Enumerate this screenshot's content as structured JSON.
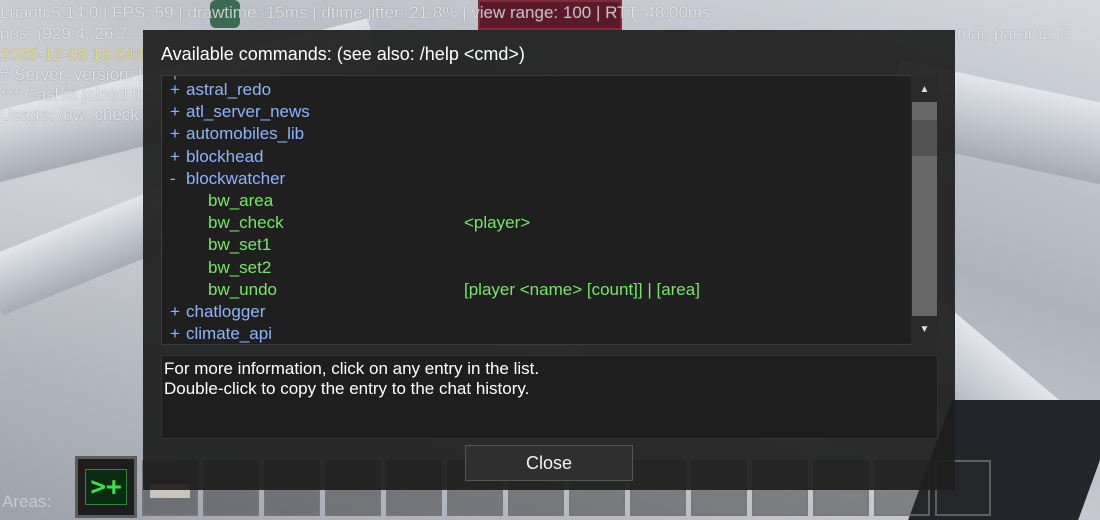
{
  "hud": {
    "line1": "Luanti 5.14.0 | FPS: 59 | drawtime: 15ms | dtime jitter: 21.8% | view range: 100 | RTT: 48.00ms",
    "line2": "pos: (929.4, 26.7, ...",
    "line2_right": "mal, param2: 0",
    "date": "2025-12-08 15:04:5",
    "chat1": "# Server: version: L",
    "chat2": "*** Cashia joined th",
    "chat3": "Usage: /bw_check",
    "areas": "Areas:"
  },
  "dialog": {
    "title": "Available commands: (see also: /help <cmd>)",
    "rows": [
      {
        "sign": "+",
        "mod": "astral_redo",
        "cmd": "",
        "args": ""
      },
      {
        "sign": "+",
        "mod": "atl_server_news",
        "cmd": "",
        "args": ""
      },
      {
        "sign": "+",
        "mod": "automobiles_lib",
        "cmd": "",
        "args": ""
      },
      {
        "sign": "+",
        "mod": "blockhead",
        "cmd": "",
        "args": ""
      },
      {
        "sign": "-",
        "mod": "blockwatcher",
        "cmd": "",
        "args": ""
      },
      {
        "sign": "",
        "mod": "",
        "cmd": "bw_area",
        "args": ""
      },
      {
        "sign": "",
        "mod": "",
        "cmd": "bw_check",
        "args": "<player>"
      },
      {
        "sign": "",
        "mod": "",
        "cmd": "bw_set1",
        "args": ""
      },
      {
        "sign": "",
        "mod": "",
        "cmd": "bw_set2",
        "args": ""
      },
      {
        "sign": "",
        "mod": "",
        "cmd": "bw_undo",
        "args": "[player <name> [count]] | [area]"
      },
      {
        "sign": "+",
        "mod": "chatlogger",
        "cmd": "",
        "args": ""
      },
      {
        "sign": "+",
        "mod": "climate_api",
        "cmd": "",
        "args": ""
      }
    ],
    "info_line1": "For more information, click on any entry in the list.",
    "info_line2": "Double-click to copy the entry to the chat history.",
    "close_label": "Close"
  },
  "hotbar": {
    "selected_icon": ">+"
  }
}
